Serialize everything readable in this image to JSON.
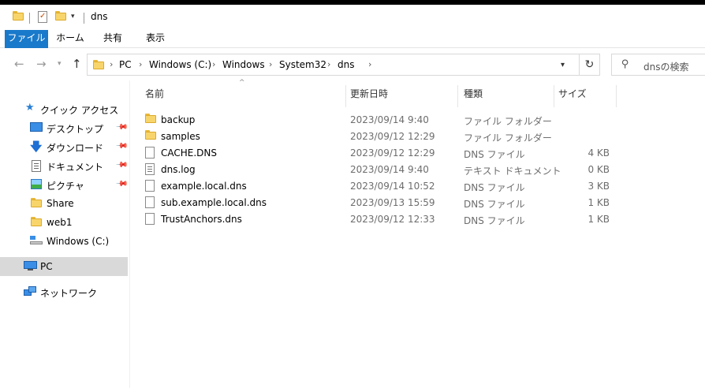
{
  "window": {
    "title": "dns"
  },
  "ribbon": {
    "tabs": [
      "ファイル",
      "ホーム",
      "共有",
      "表示"
    ]
  },
  "address": {
    "crumbs": [
      "PC",
      "Windows (C:)",
      "Windows",
      "System32",
      "dns"
    ],
    "search_placeholder": "dnsの検索"
  },
  "sidebar": {
    "items": [
      {
        "label": "クイック アクセス",
        "icon": "star-icon"
      },
      {
        "label": "デスクトップ",
        "icon": "desktop-icon",
        "pinned": true
      },
      {
        "label": "ダウンロード",
        "icon": "download-icon",
        "pinned": true
      },
      {
        "label": "ドキュメント",
        "icon": "documents-icon",
        "pinned": true
      },
      {
        "label": "ピクチャ",
        "icon": "pictures-icon",
        "pinned": true
      },
      {
        "label": "Share",
        "icon": "folder-icon"
      },
      {
        "label": "web1",
        "icon": "folder-icon"
      },
      {
        "label": "Windows (C:)",
        "icon": "drive-icon"
      },
      {
        "label": "PC",
        "icon": "pc-icon",
        "selected": true
      },
      {
        "label": "ネットワーク",
        "icon": "network-icon"
      }
    ]
  },
  "columns": [
    "名前",
    "更新日時",
    "種類",
    "サイズ"
  ],
  "files": [
    {
      "name": "backup",
      "date": "2023/09/14 9:40",
      "type": "ファイル フォルダー",
      "size": "",
      "icon": "folder-icon"
    },
    {
      "name": "samples",
      "date": "2023/09/12 12:29",
      "type": "ファイル フォルダー",
      "size": "",
      "icon": "folder-icon"
    },
    {
      "name": "CACHE.DNS",
      "date": "2023/09/12 12:29",
      "type": "DNS ファイル",
      "size": "4 KB",
      "icon": "file-icon"
    },
    {
      "name": "dns.log",
      "date": "2023/09/14 9:40",
      "type": "テキスト ドキュメント",
      "size": "0 KB",
      "icon": "text-file-icon"
    },
    {
      "name": "example.local.dns",
      "date": "2023/09/14 10:52",
      "type": "DNS ファイル",
      "size": "3 KB",
      "icon": "file-icon"
    },
    {
      "name": "sub.example.local.dns",
      "date": "2023/09/13 15:59",
      "type": "DNS ファイル",
      "size": "1 KB",
      "icon": "file-icon"
    },
    {
      "name": "TrustAnchors.dns",
      "date": "2023/09/12 12:33",
      "type": "DNS ファイル",
      "size": "1 KB",
      "icon": "file-icon"
    }
  ]
}
